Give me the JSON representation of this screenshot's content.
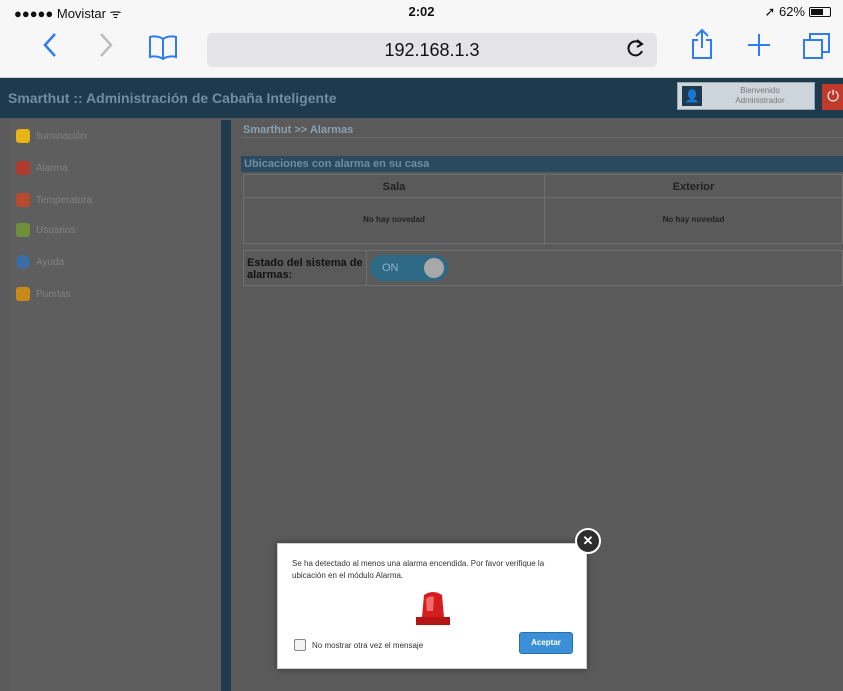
{
  "status_bar": {
    "carrier": "●●●●● Movistar ᯤ",
    "time": "2:02",
    "battery": "➚ 62%"
  },
  "browser": {
    "url": "192.168.1.3",
    "back_icon": "chevron-left-icon",
    "forward_icon": "chevron-right-icon",
    "bookmarks_icon": "book-icon",
    "reload_icon": "reload-icon",
    "share_icon": "share-icon",
    "new_tab_icon": "plus-icon",
    "tabs_icon": "tabs-icon"
  },
  "app": {
    "title": "Smarthut :: Administración de Cabaña Inteligente",
    "user": {
      "line1": "Bienvenido",
      "line2": "Administrador"
    },
    "colors": {
      "header": "#1e3b4e",
      "background": "#5a5a5a",
      "accent": "#3b8fd6",
      "alert": "#c0392b"
    }
  },
  "sidebar": {
    "items": [
      {
        "label": "Iluminación",
        "icon": "bulb-icon",
        "color": "#e7b416"
      },
      {
        "label": "Alarma",
        "icon": "siren-icon",
        "color": "#b03a2e"
      },
      {
        "label": "Temperatura",
        "icon": "thermometer-icon",
        "color": "#b54a2c"
      },
      {
        "label": "Usuarios",
        "icon": "users-icon",
        "color": "#6f8f3a"
      },
      {
        "label": "Ayuda",
        "icon": "help-icon",
        "color": "#3a6ea5"
      },
      {
        "label": "Puertas",
        "icon": "door-icon",
        "color": "#c68a18"
      }
    ]
  },
  "main": {
    "breadcrumb": "Smarthut >> Alarmas",
    "section_title": "Ubicaciones con alarma en su casa",
    "locations": [
      {
        "name": "Sala",
        "status": "No hay novedad"
      },
      {
        "name": "Exterior",
        "status": "No hay novedad"
      }
    ],
    "alarm_state_label": "Estado del sistema de alarmas:",
    "alarm_toggle": "ON"
  },
  "modal": {
    "message": "Se ha detectado al menos una alarma encendida. Por favor verifique la ubicación en el módulo Alarma.",
    "checkbox_label": "No mostrar otra vez el mensaje",
    "accept_label": "Aceptar",
    "close_label": "✕"
  }
}
